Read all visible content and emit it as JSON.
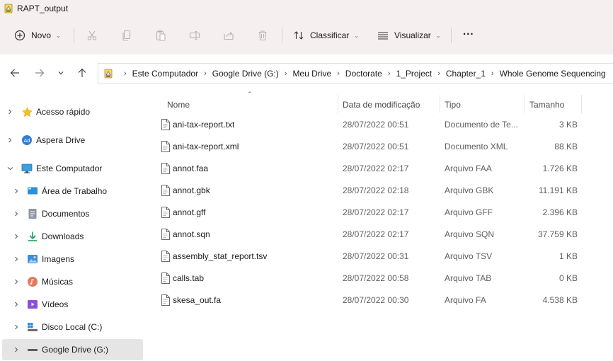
{
  "window": {
    "title": "RAPT_output",
    "title_icon": "folder-drive-icon"
  },
  "toolbar": {
    "new_label": "Novo",
    "sort_label": "Classificar",
    "view_label": "Visualizar",
    "more_label": "...",
    "icons": [
      "plus-circle-icon",
      "cut-icon",
      "copy-icon",
      "paste-icon",
      "rename-icon",
      "share-icon",
      "trash-icon",
      "sort-icon",
      "view-icon",
      "more-icon"
    ]
  },
  "navigation": {
    "back_icon": "arrow-left-icon",
    "forward_icon": "arrow-right-icon",
    "recent_icon": "chevron-down-icon",
    "up_icon": "arrow-up-icon"
  },
  "breadcrumb": [
    "Este Computador",
    "Google Drive (G:)",
    "Meu Drive",
    "Doctorate",
    "1_Project",
    "Chapter_1",
    "Whole Genome Sequencing"
  ],
  "sidebar": {
    "items": [
      {
        "label": "Acesso rápido",
        "icon": "star-icon"
      },
      {
        "label": "Aspera Drive",
        "icon": "aspera-icon"
      },
      {
        "label": "Este Computador",
        "icon": "computer-icon"
      },
      {
        "label": "Área de Trabalho",
        "icon": "desktop-icon"
      },
      {
        "label": "Documentos",
        "icon": "documents-icon"
      },
      {
        "label": "Downloads",
        "icon": "download-icon"
      },
      {
        "label": "Imagens",
        "icon": "pictures-icon"
      },
      {
        "label": "Músicas",
        "icon": "music-icon"
      },
      {
        "label": "Vídeos",
        "icon": "videos-icon"
      },
      {
        "label": "Disco Local (C:)",
        "icon": "drive-icon"
      },
      {
        "label": "Google Drive (G:)",
        "icon": "drive-icon"
      }
    ]
  },
  "columns": {
    "name": "Nome",
    "date": "Data de modificação",
    "type": "Tipo",
    "size": "Tamanho"
  },
  "files": [
    {
      "name": "ani-tax-report.txt",
      "date": "28/07/2022 00:51",
      "type": "Documento de Te...",
      "size": "3 KB"
    },
    {
      "name": "ani-tax-report.xml",
      "date": "28/07/2022 00:51",
      "type": "Documento XML",
      "size": "88 KB"
    },
    {
      "name": "annot.faa",
      "date": "28/07/2022 02:17",
      "type": "Arquivo FAA",
      "size": "1.726 KB"
    },
    {
      "name": "annot.gbk",
      "date": "28/07/2022 02:18",
      "type": "Arquivo GBK",
      "size": "11.191 KB"
    },
    {
      "name": "annot.gff",
      "date": "28/07/2022 02:17",
      "type": "Arquivo GFF",
      "size": "2.396 KB"
    },
    {
      "name": "annot.sqn",
      "date": "28/07/2022 02:17",
      "type": "Arquivo SQN",
      "size": "37.759 KB"
    },
    {
      "name": "assembly_stat_report.tsv",
      "date": "28/07/2022 00:31",
      "type": "Arquivo TSV",
      "size": "1 KB"
    },
    {
      "name": "calls.tab",
      "date": "28/07/2022 00:58",
      "type": "Arquivo TAB",
      "size": "0 KB"
    },
    {
      "name": "skesa_out.fa",
      "date": "28/07/2022 00:30",
      "type": "Arquivo FA",
      "size": "4.538 KB"
    }
  ]
}
